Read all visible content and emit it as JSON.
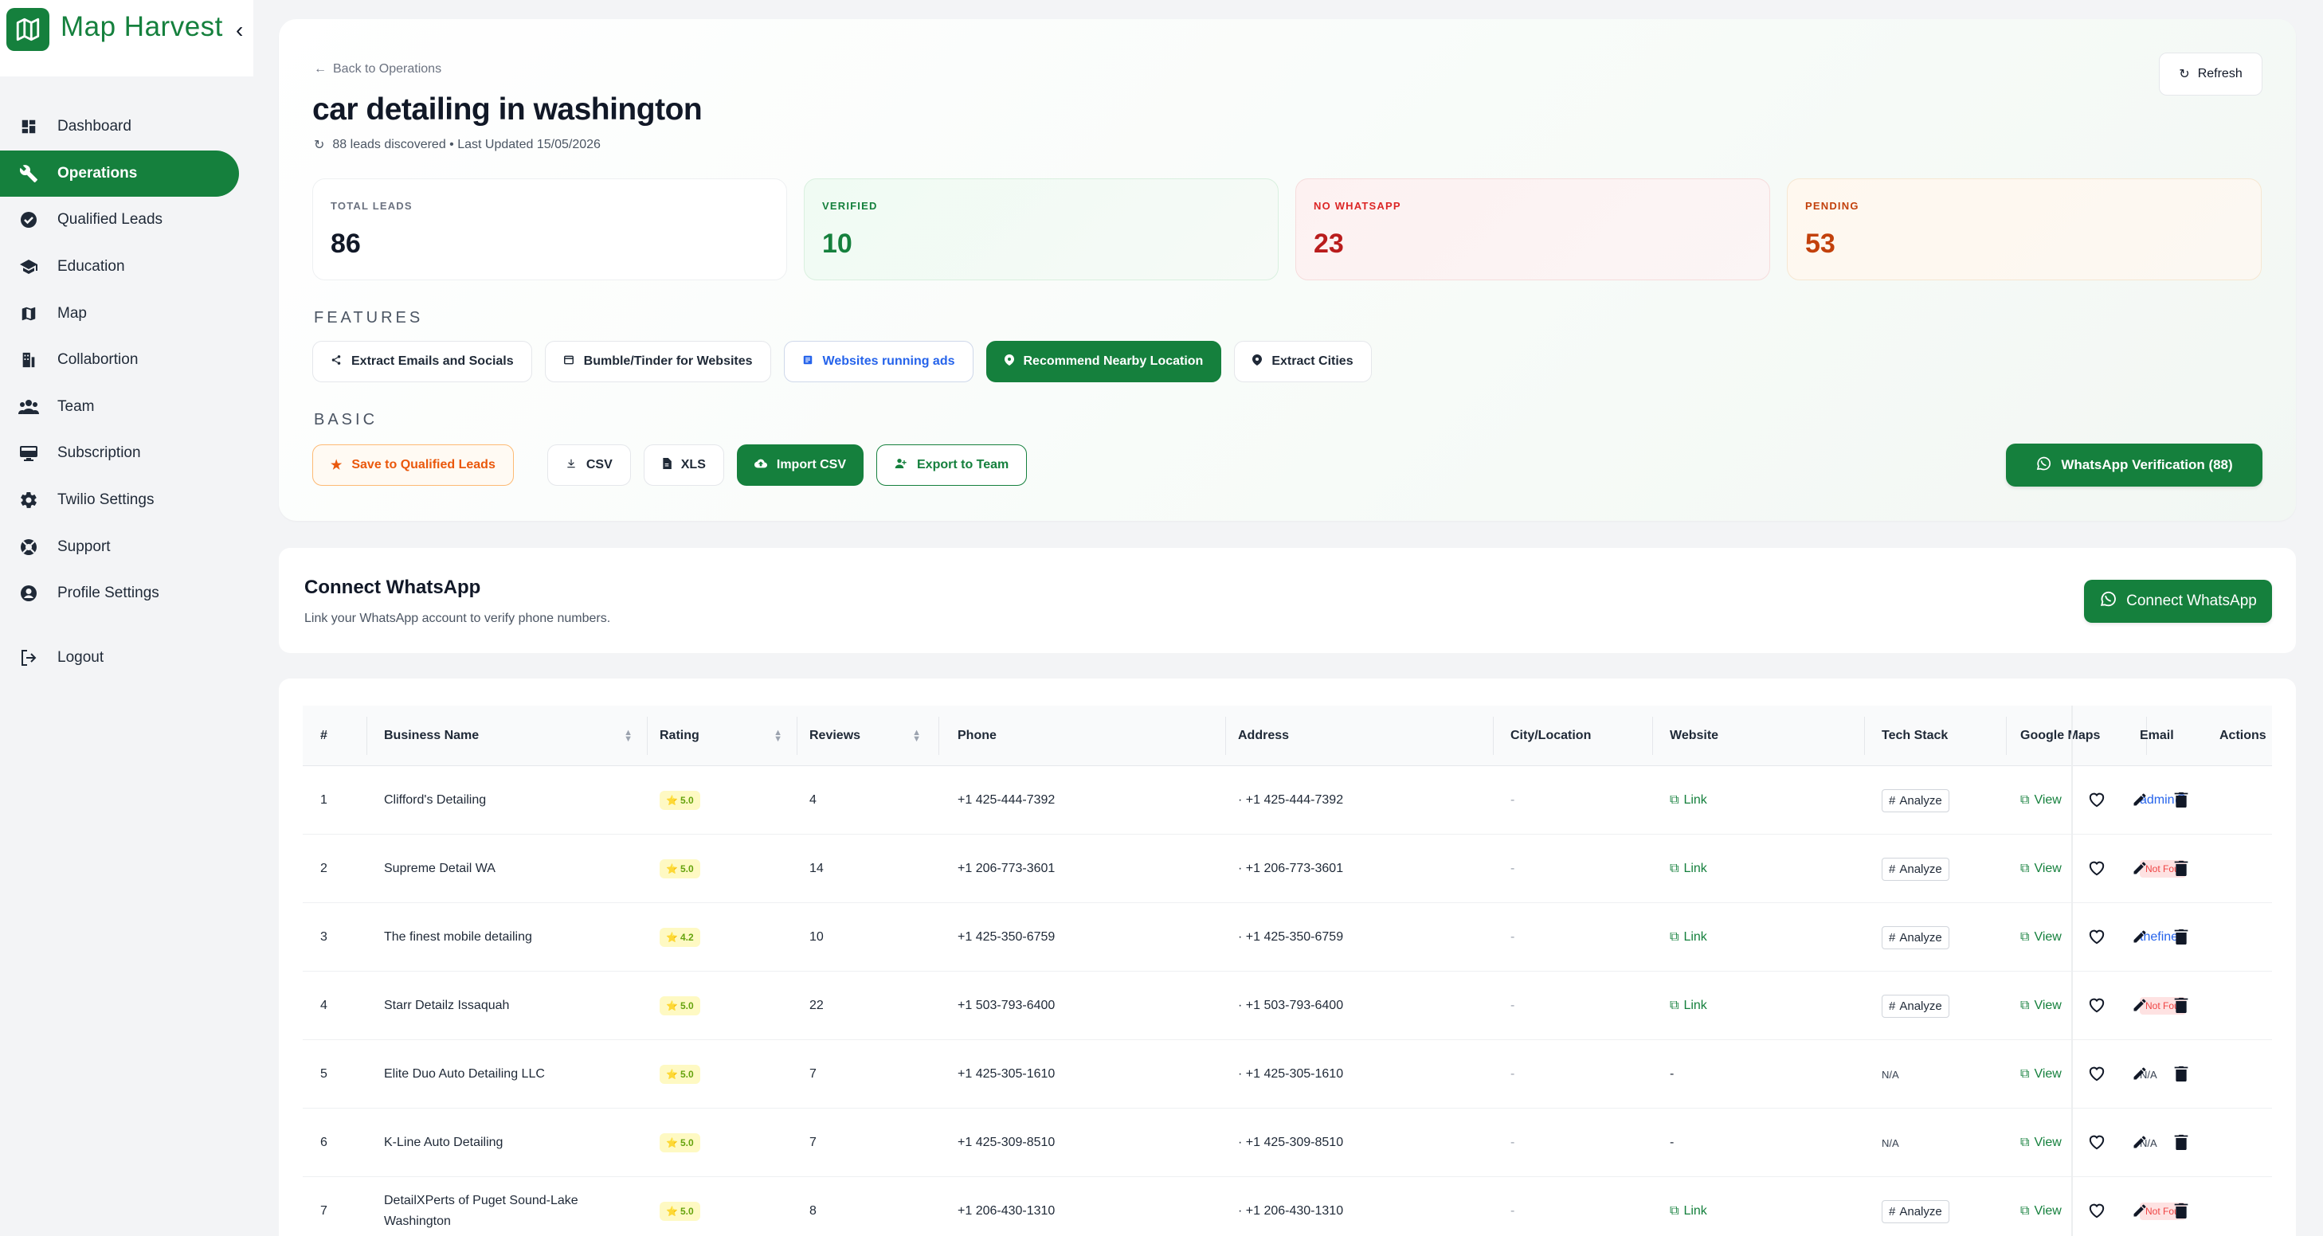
{
  "brand": {
    "name": "Map Harvest"
  },
  "nav": [
    {
      "label": "Dashboard",
      "icon": "dashboard-icon"
    },
    {
      "label": "Operations",
      "icon": "wrench-icon",
      "active": true
    },
    {
      "label": "Qualified Leads",
      "icon": "verified-badge-icon"
    },
    {
      "label": "Education",
      "icon": "graduation-cap-icon"
    },
    {
      "label": "Map",
      "icon": "map-icon"
    },
    {
      "label": "Collabortion",
      "icon": "building-icon"
    },
    {
      "label": "Team",
      "icon": "team-icon"
    },
    {
      "label": "Subscription",
      "icon": "monitor-icon"
    },
    {
      "label": "Twilio Settings",
      "icon": "gear-icon"
    },
    {
      "label": "Support",
      "icon": "support-icon"
    },
    {
      "label": "Profile Settings",
      "icon": "user-circle-icon"
    },
    {
      "label": "Logout",
      "icon": "logout-icon"
    }
  ],
  "header": {
    "back_label": "Back to Operations",
    "title": "car detailing in washington",
    "subline": "88 leads discovered • Last Updated 15/05/2026",
    "refresh_label": "Refresh"
  },
  "stats": {
    "total": {
      "label": "TOTAL LEADS",
      "value": "86"
    },
    "verified": {
      "label": "VERIFIED",
      "value": "10"
    },
    "no_whatsapp": {
      "label": "NO WHATSAPP",
      "value": "23"
    },
    "pending": {
      "label": "PENDING",
      "value": "53"
    }
  },
  "features": {
    "heading": "FEATURES",
    "items": [
      {
        "label": "Extract Emails and Socials",
        "icon": "share-icon"
      },
      {
        "label": "Bumble/Tinder for Websites",
        "icon": "window-icon"
      },
      {
        "label": "Websites running ads",
        "icon": "list-icon"
      },
      {
        "label": "Recommend Nearby Location",
        "icon": "pin-icon"
      },
      {
        "label": "Extract Cities",
        "icon": "pin-icon"
      }
    ]
  },
  "basic": {
    "heading": "BASIC",
    "save_label": "Save to Qualified Leads",
    "csv_label": "CSV",
    "xls_label": "XLS",
    "import_label": "Import CSV",
    "export_label": "Export to Team",
    "whatsapp_verify_label": "WhatsApp Verification (88)"
  },
  "connect": {
    "title": "Connect WhatsApp",
    "desc": "Link your WhatsApp account to verify phone numbers.",
    "button_label": "Connect WhatsApp"
  },
  "table": {
    "columns": [
      "#",
      "Business Name",
      "Rating",
      "Reviews",
      "Phone",
      "Address",
      "City/Location",
      "Website",
      "Tech Stack",
      "Google Maps",
      "Email",
      "Actions"
    ],
    "rows": [
      {
        "num": "1",
        "name": "Clifford's Detailing",
        "rating": "5.0",
        "reviews": "4",
        "phone": "+1 425-444-7392",
        "address": "· +1 425-444-7392",
        "city": "-",
        "website": "Link",
        "tech": "Analyze",
        "maps": "View",
        "email": "admin@",
        "email_type": "link"
      },
      {
        "num": "2",
        "name": "Supreme Detail WA",
        "rating": "5.0",
        "reviews": "14",
        "phone": "+1 206-773-3601",
        "address": "· +1 206-773-3601",
        "city": "-",
        "website": "Link",
        "tech": "Analyze",
        "maps": "View",
        "email": "Not Found",
        "email_type": "notfound"
      },
      {
        "num": "3",
        "name": "The finest mobile detailing",
        "rating": "4.2",
        "reviews": "10",
        "phone": "+1 425-350-6759",
        "address": "· +1 425-350-6759",
        "city": "-",
        "website": "Link",
        "tech": "Analyze",
        "maps": "View",
        "email": "thefines",
        "email_type": "link"
      },
      {
        "num": "4",
        "name": "Starr Detailz Issaquah",
        "rating": "5.0",
        "reviews": "22",
        "phone": "+1 503-793-6400",
        "address": "· +1 503-793-6400",
        "city": "-",
        "website": "Link",
        "tech": "Analyze",
        "maps": "View",
        "email": "Not Found",
        "email_type": "notfound"
      },
      {
        "num": "5",
        "name": "Elite Duo Auto Detailing LLC",
        "rating": "5.0",
        "reviews": "7",
        "phone": "+1 425-305-1610",
        "address": "· +1 425-305-1610",
        "city": "-",
        "website": "-",
        "tech": "N/A",
        "maps": "View",
        "email": "N/A",
        "email_type": "na"
      },
      {
        "num": "6",
        "name": "K-Line Auto Detailing",
        "rating": "5.0",
        "reviews": "7",
        "phone": "+1 425-309-8510",
        "address": "· +1 425-309-8510",
        "city": "-",
        "website": "-",
        "tech": "N/A",
        "maps": "View",
        "email": "N/A",
        "email_type": "na"
      },
      {
        "num": "7",
        "name": "DetailXPerts of Puget Sound-Lake Washington",
        "rating": "5.0",
        "reviews": "8",
        "phone": "+1 206-430-1310",
        "address": "· +1 206-430-1310",
        "city": "-",
        "website": "Link",
        "tech": "Analyze",
        "maps": "View",
        "email": "Not Found",
        "email_type": "notfound"
      }
    ]
  },
  "colors": {
    "brand_green": "#15803d",
    "danger": "#dc2626",
    "warning": "#c2410c",
    "link_blue": "#2563eb"
  }
}
